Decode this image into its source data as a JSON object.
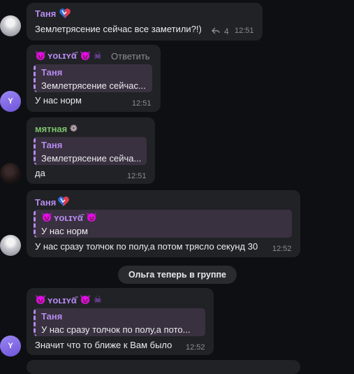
{
  "messages": [
    {
      "author": "Таня",
      "text": "Землетрясение сейчас все заметили?!)",
      "reply_count": "4",
      "time": "12:51"
    },
    {
      "author": "ʏᴏʟɪʏᾱ̄",
      "reply_action": "Ответить",
      "quote_author": "Таня",
      "quote_text": "Землетрясение сейчас...",
      "text": "У нас норм",
      "time": "12:51",
      "avatar_letter": "Y"
    },
    {
      "author": "мятная",
      "quote_author": "Таня",
      "quote_text": "Землетрясение сейча...",
      "text": "да",
      "time": "12:51"
    },
    {
      "author": "Таня",
      "quote_author": "ʏᴏʟɪʏᾱ̄",
      "quote_text": "У нас норм",
      "text": "У нас сразу толчок по полу,а потом трясло секунд 30",
      "time": "12:52"
    },
    {
      "author": "ʏᴏʟɪʏᾱ̄",
      "quote_author": "Таня",
      "quote_text": "У нас сразу толчок по полу,а пото...",
      "text": "Значит что то ближе к Вам было",
      "time": "12:52",
      "avatar_letter": "Y"
    }
  ],
  "service_message": "Ольга теперь в группе",
  "colors": {
    "background": "#0e0f12",
    "bubble": "#212226",
    "quote_bg": "#3a3140",
    "accent_purple": "#b68bf0",
    "accent_green": "#7cc36b"
  }
}
